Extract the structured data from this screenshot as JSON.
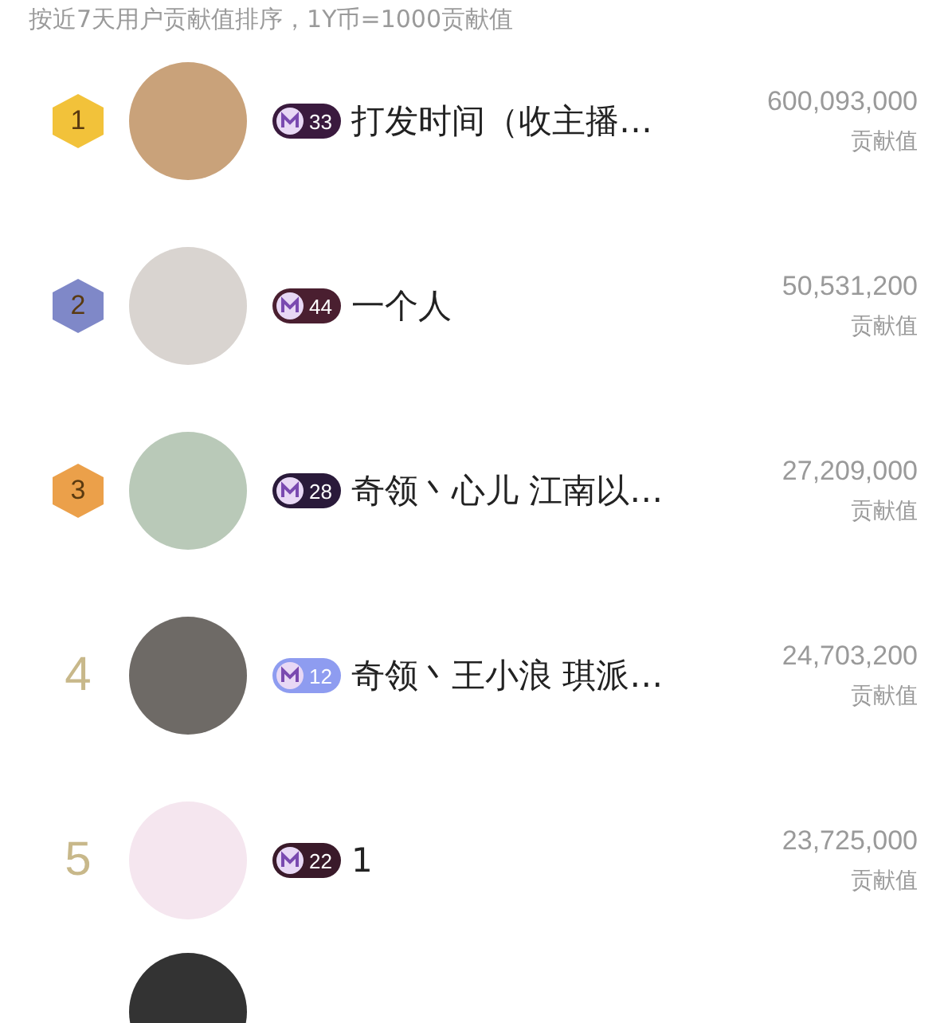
{
  "header": {
    "note": "按近7天用户贡献值排序，1Y币=1000贡献值"
  },
  "rows": [
    {
      "rank": {
        "text": "1",
        "kind": "medal",
        "color": "#f2c23a"
      },
      "badge": {
        "text": "33",
        "color": "#3a1a3e"
      },
      "name": "打发时间（收主播…",
      "amount": "600,093,000",
      "amount_label": "贡献值"
    },
    {
      "rank": {
        "text": "2",
        "kind": "medal",
        "color": "#7f88c8"
      },
      "badge": {
        "text": "44",
        "color": "#4a1f30"
      },
      "name": "一个人",
      "amount": "50,531,200",
      "amount_label": "贡献值"
    },
    {
      "rank": {
        "text": "3",
        "kind": "medal",
        "color": "#eba04a"
      },
      "badge": {
        "text": "28",
        "color": "#2a1a3a"
      },
      "name": "奇领丶心儿 江南以…",
      "amount": "27,209,000",
      "amount_label": "贡献值"
    },
    {
      "rank": {
        "text": "4",
        "kind": "plain",
        "color": "#c8b88a"
      },
      "badge": {
        "text": "12",
        "color": "#8e9cf0"
      },
      "name": "奇领丶王小浪 琪派…",
      "amount": "24,703,200",
      "amount_label": "贡献值"
    },
    {
      "rank": {
        "text": "5",
        "kind": "plain",
        "color": "#c8b88a"
      },
      "badge": {
        "text": "22",
        "color": "#3a1a2a"
      },
      "name": "1",
      "amount": "23,725,000",
      "amount_label": "贡献值"
    }
  ],
  "more_rows_below": true
}
